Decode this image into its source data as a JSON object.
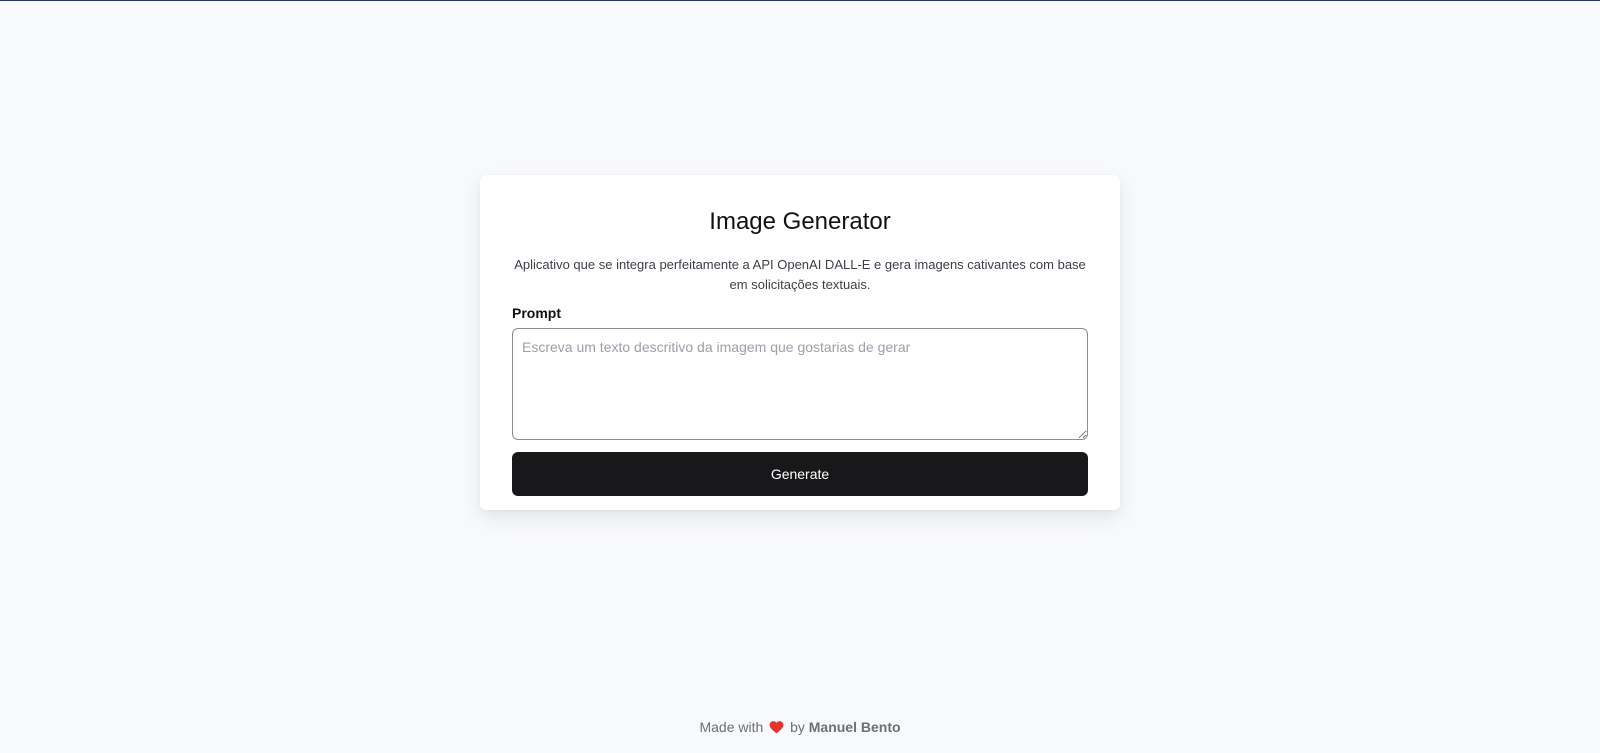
{
  "app": {
    "title": "Image Generator",
    "description": "Aplicativo que se integra perfeitamente a API OpenAI DALL-E e gera imagens cativantes com base em solicitações textuais."
  },
  "form": {
    "prompt_label": "Prompt",
    "prompt_value": "",
    "prompt_placeholder": "Escreva um texto descritivo da imagem que gostarias de gerar",
    "generate_label": "Generate"
  },
  "footer": {
    "made_with": "Made with",
    "icon": "heart-icon",
    "by": "by",
    "author": "Manuel Bento"
  },
  "colors": {
    "background": "#f8f9fb",
    "card": "#ffffff",
    "button": "#18181b",
    "heart": "#e5322d"
  }
}
